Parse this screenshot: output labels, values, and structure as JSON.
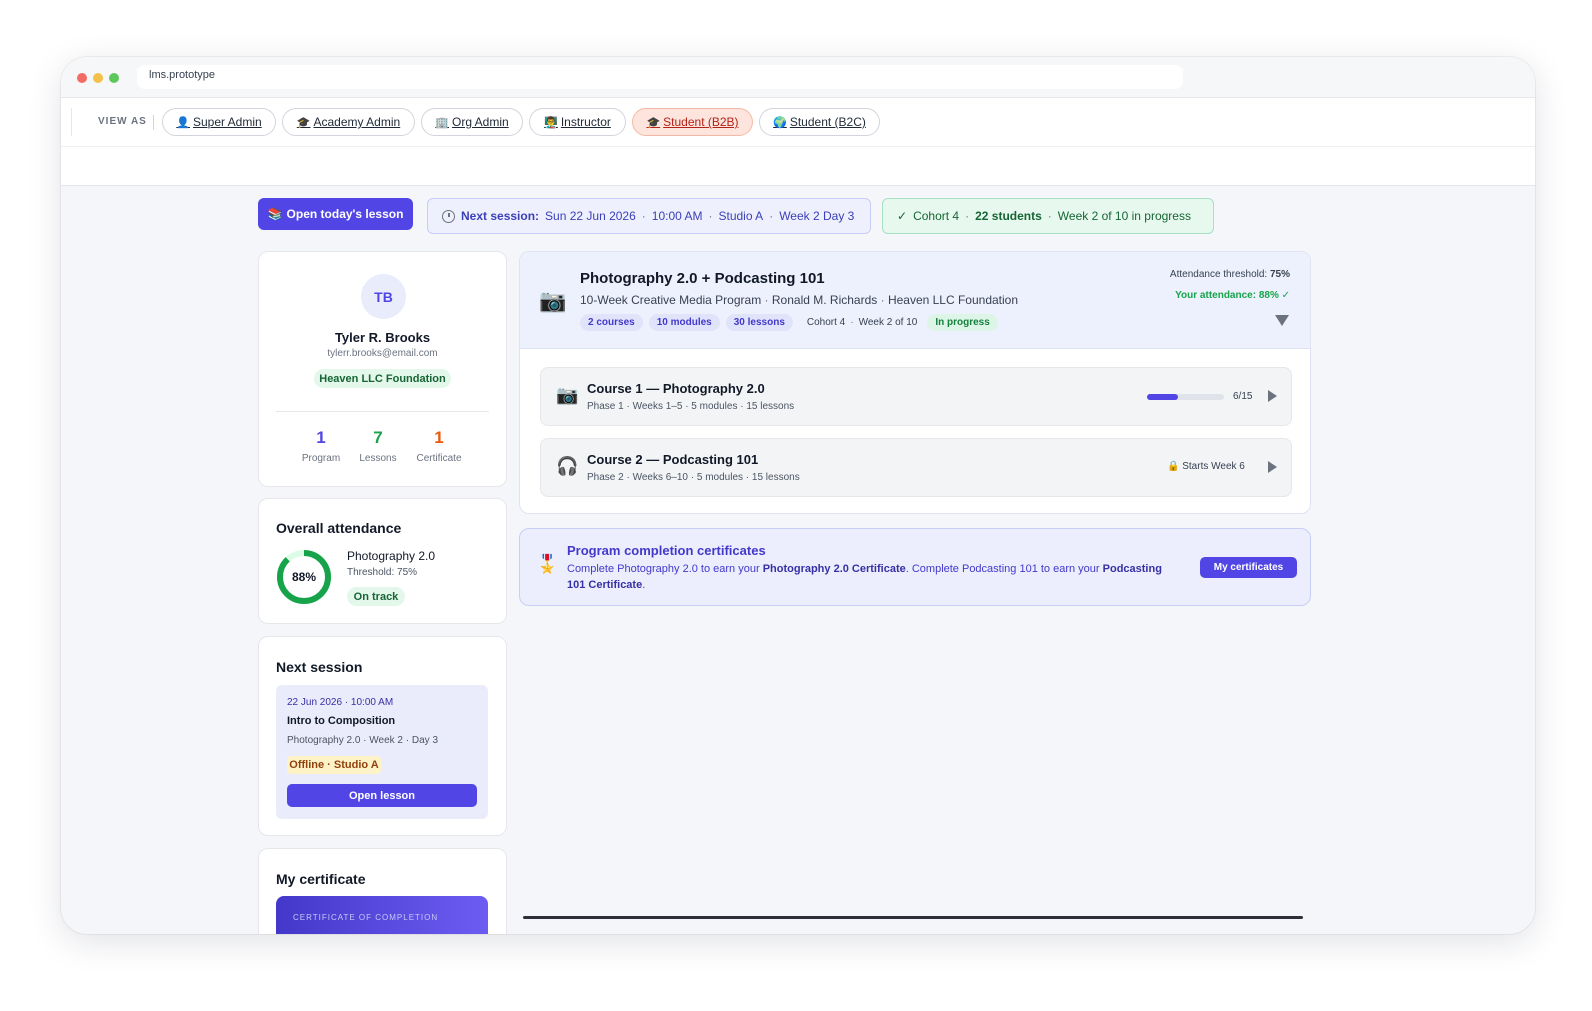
{
  "browser": {
    "url": "lms.prototype"
  },
  "view_as": {
    "label": "VIEW AS",
    "roles": [
      {
        "icon": "👤",
        "label": "Super Admin"
      },
      {
        "icon": "🎓",
        "label": "Academy Admin"
      },
      {
        "icon": "🏢",
        "label": "Org Admin"
      },
      {
        "icon": "👨‍🏫",
        "label": "Instructor"
      },
      {
        "icon": "🎓",
        "label": "Student (B2B)"
      },
      {
        "icon": "🌍",
        "label": "Student (B2C)"
      }
    ]
  },
  "top_actions": {
    "open_lesson": {
      "icon": "📚",
      "label": "Open today's lesson"
    },
    "next_session": {
      "label": "Next session:",
      "date": "Sun 22 Jun 2026",
      "time": "10:00 AM",
      "location": "Studio A",
      "week": "Week 2 Day 3"
    },
    "cohort": {
      "check": "✓",
      "name": "Cohort 4",
      "students": "22 students",
      "progress": "Week 2 of 10 in progress"
    }
  },
  "profile": {
    "initials": "TB",
    "name": "Tyler R. Brooks",
    "email": "tylerr.brooks@email.com",
    "org": "Heaven LLC Foundation",
    "stats": [
      {
        "value": "1",
        "label": "Program",
        "color": "#4f46e5"
      },
      {
        "value": "7",
        "label": "Lessons",
        "color": "#16a34a"
      },
      {
        "value": "1",
        "label": "Certificate",
        "color": "#ea580c"
      }
    ]
  },
  "attendance": {
    "title": "Overall attendance",
    "percent_label": "88%",
    "percent": 88,
    "course": "Photography 2.0",
    "threshold": "Threshold: 75%",
    "status": "On track"
  },
  "next_session_card": {
    "title": "Next session",
    "datetime": "22 Jun 2026 · 10:00 AM",
    "lesson": "Intro to Composition",
    "meta": "Photography 2.0 · Week 2 · Day 3",
    "mode": "Offline · Studio A",
    "button": "Open lesson"
  },
  "my_certificate": {
    "title": "My certificate",
    "preview_label": "CERTIFICATE OF COMPLETION"
  },
  "program": {
    "icon": "📷",
    "title": "Photography 2.0 + Podcasting 101",
    "subtitle": "10-Week Creative Media Program",
    "instructor": "Ronald M. Richards",
    "org": "Heaven LLC Foundation",
    "tags": [
      "2 courses",
      "10 modules",
      "30 lessons"
    ],
    "cohort": "Cohort 4",
    "week": "Week 2 of 10",
    "status": "In progress",
    "threshold_label": "Attendance threshold:",
    "threshold_value": "75%",
    "your_attendance": "Your attendance: 88% ✓"
  },
  "courses": [
    {
      "icon": "📷",
      "title": "Course 1 — Photography 2.0",
      "meta": "Phase 1 · Weeks 1–5 · 5 modules · 15 lessons",
      "progress_label": "6/15",
      "progress": 0.4
    },
    {
      "icon": "🎧",
      "title": "Course 2 — Podcasting 101",
      "meta": "Phase 2 · Weeks 6–10 · 5 modules · 15 lessons",
      "lock_label": "🔒 Starts Week 6"
    }
  ],
  "cert_banner": {
    "icon": "🎖️",
    "title": "Program completion certificates",
    "text1": "Complete Photography 2.0 to earn your ",
    "bold1": "Photography 2.0 Certificate",
    "text2": ". Complete Podcasting 101 to earn your ",
    "bold2": "Podcasting 101 Certificate",
    "text3": ".",
    "button": "My certificates"
  },
  "colors": {
    "primary": "#5146e5",
    "success": "#16a34a",
    "accent_orange": "#ea580c"
  }
}
